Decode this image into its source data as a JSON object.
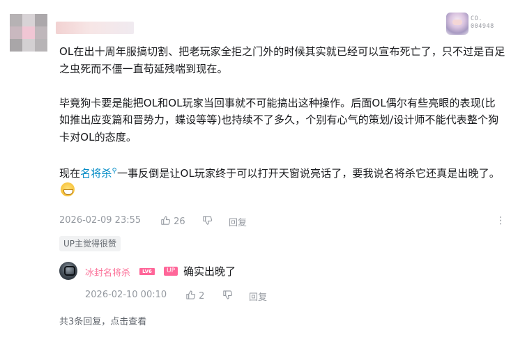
{
  "comment": {
    "username": "",
    "fan_badge": {
      "line1": "CO.",
      "line2": "004948"
    },
    "paragraphs": [
      {
        "text": "OL在出十周年服搞切割、把老玩家全拒之门外的时候其实就已经可以宣布死亡了，只不过是百足之虫死而不僵一直苟延残喘到现在。"
      },
      {
        "text": "毕竟狗卡要是能把OL和OL玩家当回事就不可能搞出这种操作。后面OL偶尔有些亮眼的表现(比如推出应变篇和晋势力，蝶设等等)也持续不了多久，个别有心气的策划/设计师不能代表整个狗卡对OL的态度。"
      }
    ],
    "last_paragraph": {
      "before": "现在",
      "keyword": "名将杀",
      "after": "一事反倒是让OL玩家终于可以打开天窗说亮话了，要我说名将杀它还真是出晚了。",
      "emote": "grin-emote"
    },
    "timestamp": "2026-02-09 23:55",
    "like_count": "26",
    "reply_label": "回复",
    "up_liked_tag": "UP主觉得很赞",
    "more_icon": "more-vertical-icon"
  },
  "reply": {
    "username": "冰封名将杀",
    "level_badge": "LV6",
    "up_badge": "UP",
    "text": "确实出晚了",
    "timestamp": "2026-02-10 00:10",
    "like_count": "2",
    "reply_label": "回复"
  },
  "total_replies": "共3条回复，点击查看",
  "colors": {
    "accent_pink": "#fb7299",
    "keyword_blue": "#008ac5",
    "meta_gray": "#9499a0"
  }
}
